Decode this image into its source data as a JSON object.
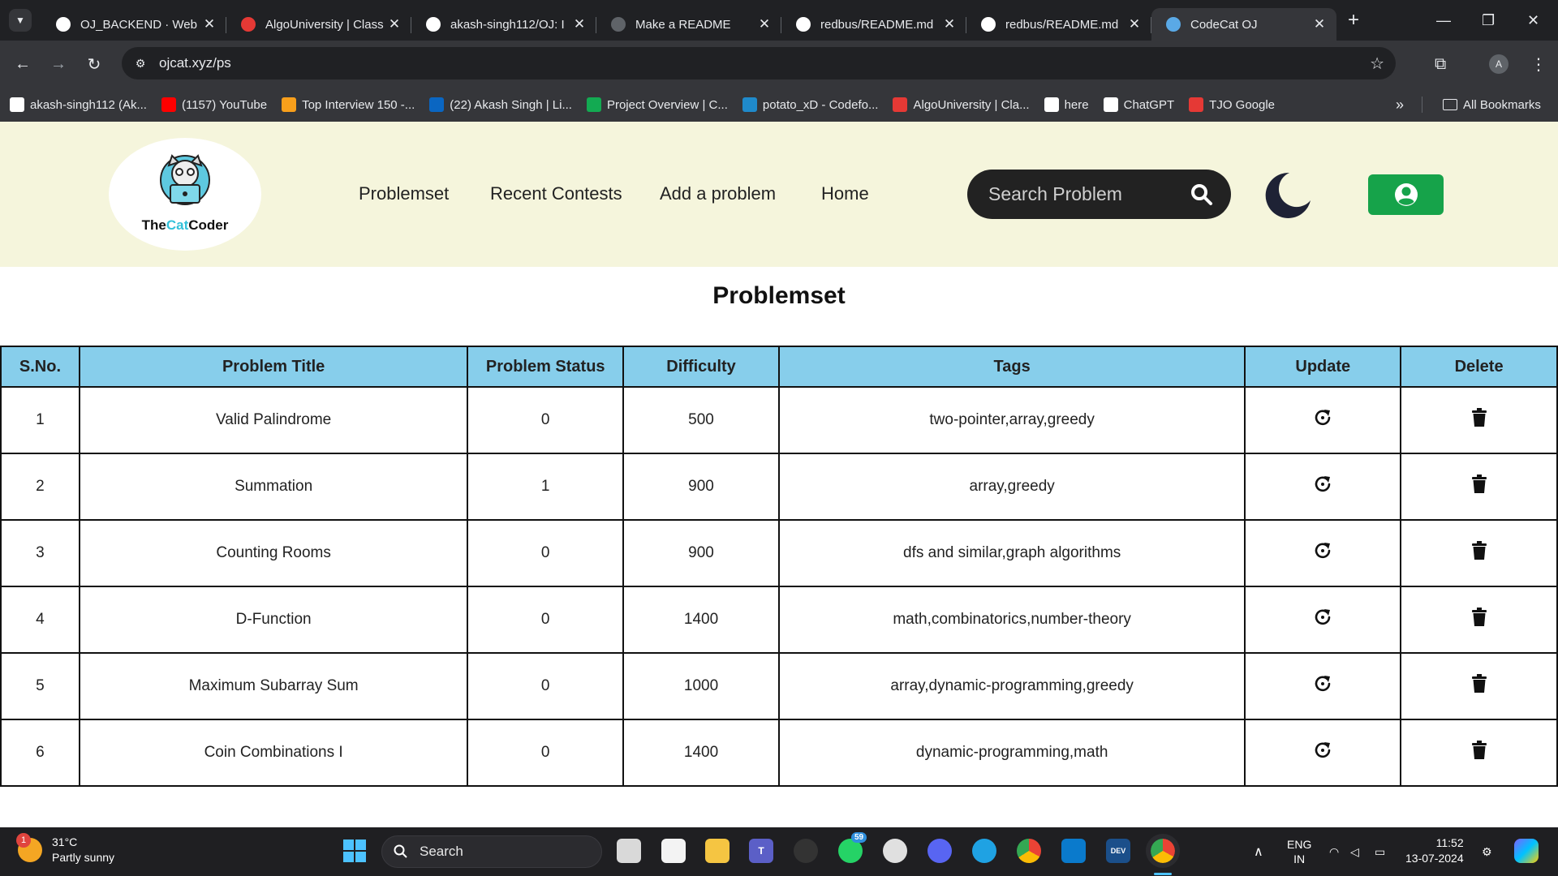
{
  "browser": {
    "tabs": [
      {
        "title": "OJ_BACKEND · Web",
        "icon": "render-icon",
        "color": "#ffffff"
      },
      {
        "title": "AlgoUniversity | Class",
        "icon": "algouniversity-icon",
        "color": "#e53935"
      },
      {
        "title": "akash-singh112/OJ: I",
        "icon": "github-icon",
        "color": "#ffffff"
      },
      {
        "title": "Make a README",
        "icon": "page-icon",
        "color": "#5f6368"
      },
      {
        "title": "redbus/README.md",
        "icon": "github-icon",
        "color": "#ffffff"
      },
      {
        "title": "redbus/README.md",
        "icon": "github-icon",
        "color": "#ffffff"
      },
      {
        "title": "CodeCat OJ",
        "icon": "codecat-icon",
        "color": "#5aa9e6"
      }
    ],
    "url": "ojcat.xyz/ps",
    "profile_initial": "A",
    "bookmarks": [
      {
        "label": "akash-singh112 (Ak...",
        "icon": "github-icon",
        "color": "#ffffff"
      },
      {
        "label": "(1157) YouTube",
        "icon": "youtube-icon",
        "color": "#ff0000"
      },
      {
        "label": "Top Interview 150 -...",
        "icon": "leetcode-icon",
        "color": "#f89f1b"
      },
      {
        "label": "(22) Akash Singh | Li...",
        "icon": "linkedin-icon",
        "color": "#0a66c2"
      },
      {
        "label": "Project Overview | C...",
        "icon": "mongodb-icon",
        "color": "#13aa52"
      },
      {
        "label": "potato_xD - Codefo...",
        "icon": "codeforces-icon",
        "color": "#1f8acb"
      },
      {
        "label": "AlgoUniversity | Cla...",
        "icon": "algouniversity-icon",
        "color": "#e53935"
      },
      {
        "label": "here",
        "icon": "github-icon",
        "color": "#ffffff"
      },
      {
        "label": "ChatGPT",
        "icon": "chatgpt-icon",
        "color": "#ffffff"
      },
      {
        "label": "TJO Google",
        "icon": "pin-icon",
        "color": "#e53935"
      }
    ],
    "all_bookmarks": "All Bookmarks"
  },
  "site": {
    "brand": {
      "part1": "The",
      "part2": "Cat",
      "part3": "Coder"
    },
    "nav": [
      "Problemset",
      "Recent Contests",
      "Add a problem",
      "Home"
    ],
    "search_placeholder": "Search Problem"
  },
  "page": {
    "title": "Problemset",
    "columns": [
      "S.No.",
      "Problem Title",
      "Problem Status",
      "Difficulty",
      "Tags",
      "Update",
      "Delete"
    ],
    "rows": [
      {
        "sno": "1",
        "title": "Valid Palindrome",
        "status": "0",
        "difficulty": "500",
        "tags": "two-pointer,array,greedy"
      },
      {
        "sno": "2",
        "title": "Summation",
        "status": "1",
        "difficulty": "900",
        "tags": "array,greedy"
      },
      {
        "sno": "3",
        "title": "Counting Rooms",
        "status": "0",
        "difficulty": "900",
        "tags": "dfs and similar,graph algorithms"
      },
      {
        "sno": "4",
        "title": "D-Function",
        "status": "0",
        "difficulty": "1400",
        "tags": "math,combinatorics,number-theory"
      },
      {
        "sno": "5",
        "title": "Maximum Subarray Sum",
        "status": "0",
        "difficulty": "1000",
        "tags": "array,dynamic-programming,greedy"
      },
      {
        "sno": "6",
        "title": "Coin Combinations I",
        "status": "0",
        "difficulty": "1400",
        "tags": "dynamic-programming,math"
      }
    ]
  },
  "taskbar": {
    "weather_temp": "31°C",
    "weather_desc": "Partly sunny",
    "weather_badge": "1",
    "search_label": "Search",
    "whatsapp_badge": "59",
    "lang1": "ENG",
    "lang2": "IN",
    "time": "11:52",
    "date": "13-07-2024"
  }
}
